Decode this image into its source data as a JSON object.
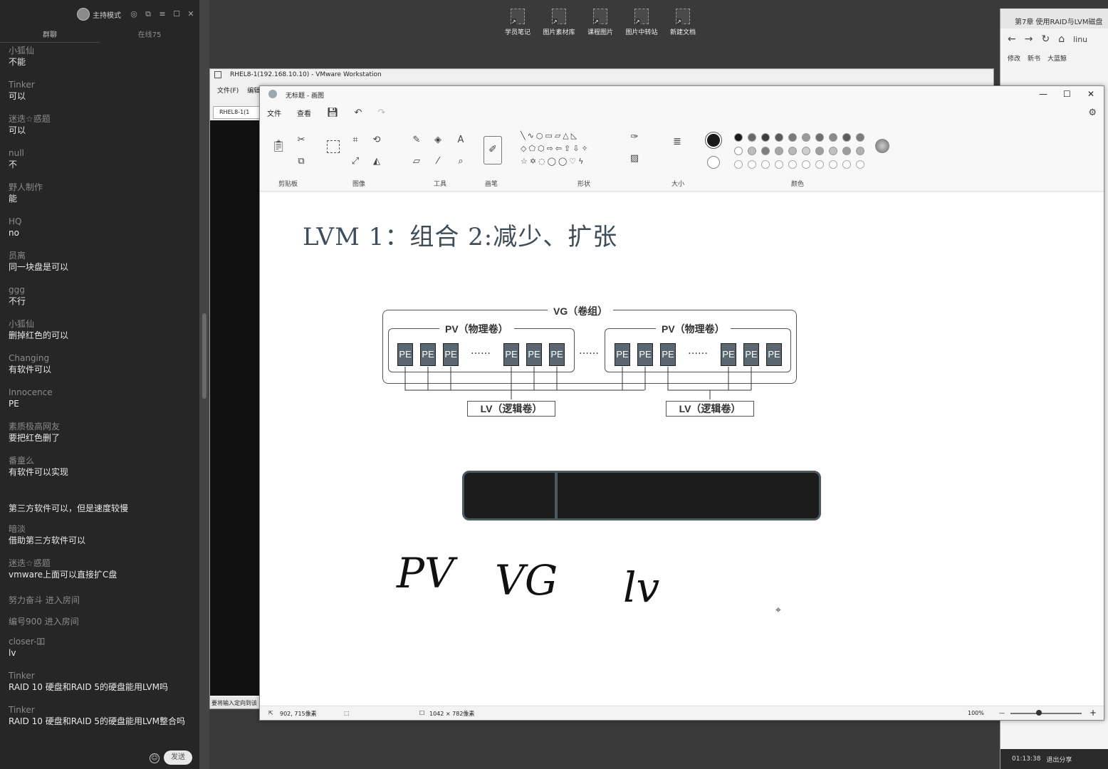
{
  "chat": {
    "host_label": "主持模式",
    "tabs": [
      "群聊",
      "在线75"
    ],
    "messages": [
      {
        "name": "小狐仙",
        "text": "不能"
      },
      {
        "name": "Tinker",
        "text": "可以"
      },
      {
        "name": "迷迭☆惑题",
        "text": "可以"
      },
      {
        "name": "null",
        "text": "不"
      },
      {
        "name": "野人制作",
        "text": "能"
      },
      {
        "name": "HQ",
        "text": "no"
      },
      {
        "name": "员离",
        "text": "同一块盘是可以"
      },
      {
        "name": "ggg",
        "text": "不行"
      },
      {
        "name": "小狐仙",
        "text": "删掉红色的可以"
      },
      {
        "name": "Changing",
        "text": "有软件可以"
      },
      {
        "name": "Innocence",
        "text": "PE"
      },
      {
        "name": "素质极高网友",
        "text": "要把红色删了"
      },
      {
        "name": "番童么",
        "text": "有软件可以实现"
      },
      {
        "name": "",
        "text": "第三方软件可以，但是速度较慢"
      },
      {
        "name": "暗淡",
        "text": "借助第三方软件可以"
      },
      {
        "name": "迷迭☆惑题",
        "text": "vmware上面可以直接扩C盘"
      }
    ],
    "system": [
      "努力奋斗 进入房间",
      "编号900 进入房间"
    ],
    "messages2": [
      {
        "name": "closer-吅",
        "text": "lv"
      },
      {
        "name": "Tinker",
        "text": "RAID 10 硬盘和RAID 5的硬盘能用LVM吗"
      },
      {
        "name": "Tinker",
        "text": "RAID 10 硬盘和RAID 5的硬盘能用LVM整合吗"
      }
    ],
    "send_label": "发送"
  },
  "desktop_icons": [
    "学员笔记",
    "图片素材库",
    "课程图片",
    "图片中转站",
    "新建文档"
  ],
  "browser": {
    "tab_title": "第7章 使用RAID与LVM磁盘",
    "address": "linu",
    "bookmarks": [
      "修改",
      "新书",
      "大蓝鲸"
    ],
    "time": "01:13:38",
    "exit_label": "退出分享"
  },
  "vmware": {
    "title": "RHEL8-1(192.168.10.10) - VMware Workstation",
    "menu": [
      "文件(F)",
      "编辑"
    ],
    "tab": "RHEL8-1(1",
    "status": "要将输入定向到该"
  },
  "paint": {
    "title": "无标题 - 画图",
    "menu": [
      "文件",
      "查看"
    ],
    "groups": [
      "剪贴板",
      "图像",
      "工具",
      "画笔",
      "形状",
      "大小",
      "颜色"
    ],
    "status_pos": "902, 715像素",
    "status_size": "1042 × 782像素",
    "zoom": "100%",
    "palette_row1": [
      "#1a1a1a",
      "#6a6a6a",
      "#3c3c3c",
      "#5a5a5a",
      "#7a7a7a",
      "#9a9a9a",
      "#6e6e6e",
      "#8a8a8a",
      "#5c5c5c",
      "#7c7c7c"
    ],
    "palette_row2": [
      "#ffffff",
      "#bdbdbd",
      "#7f7f7f",
      "#a8a8a8",
      "#b8b8b8",
      "#cfcfcf",
      "#a0a0a0",
      "#c0c0c0",
      "#9c9c9c",
      "#b0b0b0"
    ]
  },
  "canvas": {
    "heading": "LVM  1：组合  2:减少、扩张",
    "vg_label": "VG（卷组）",
    "pv_label": "PV（物理卷）",
    "pe_label": "PE",
    "lv_label": "LV（逻辑卷）",
    "dots": "……",
    "handwriting": [
      "PV",
      "VG",
      "lv"
    ]
  }
}
